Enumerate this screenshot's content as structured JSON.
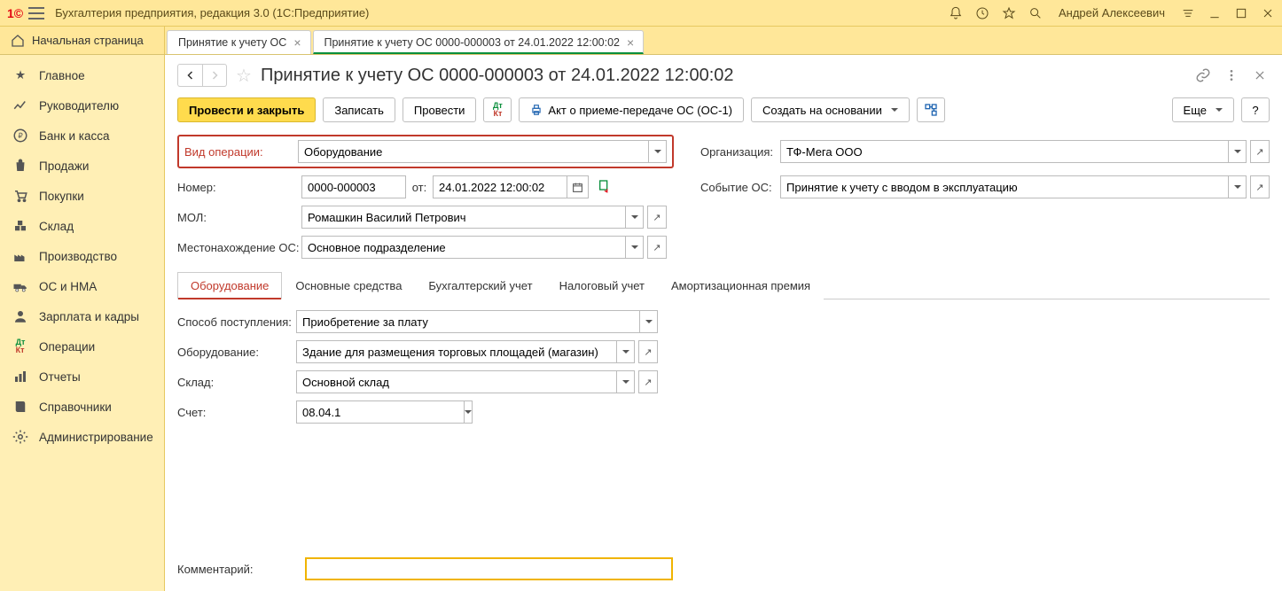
{
  "titlebar": {
    "app_title": "Бухгалтерия предприятия, редакция 3.0  (1С:Предприятие)",
    "user": "Андрей Алексеевич"
  },
  "hometab": "Начальная страница",
  "tabs": [
    {
      "label": "Принятие к учету ОС"
    },
    {
      "label": "Принятие к учету ОС 0000-000003 от 24.01.2022 12:00:02"
    }
  ],
  "sidebar": {
    "items": [
      "Главное",
      "Руководителю",
      "Банк и касса",
      "Продажи",
      "Покупки",
      "Склад",
      "Производство",
      "ОС и НМА",
      "Зарплата и кадры",
      "Операции",
      "Отчеты",
      "Справочники",
      "Администрирование"
    ]
  },
  "page": {
    "title": "Принятие к учету ОС 0000-000003 от 24.01.2022 12:00:02"
  },
  "toolbar": {
    "post_close": "Провести и закрыть",
    "write": "Записать",
    "post": "Провести",
    "print_act": "Акт о приеме-передаче ОС (ОС-1)",
    "create_based": "Создать на основании",
    "more": "Еще"
  },
  "form": {
    "op_type_lbl": "Вид операции:",
    "op_type_val": "Оборудование",
    "org_lbl": "Организация:",
    "org_val": "ТФ-Мега ООО",
    "num_lbl": "Номер:",
    "num_val": "0000-000003",
    "from_lbl": "от:",
    "date_val": "24.01.2022 12:00:02",
    "event_lbl": "Событие ОС:",
    "event_val": "Принятие к учету с вводом в эксплуатацию",
    "mol_lbl": "МОЛ:",
    "mol_val": "Ромашкин Василий Петрович",
    "loc_lbl": "Местонахождение ОС:",
    "loc_val": "Основное подразделение"
  },
  "subtabs": [
    "Оборудование",
    "Основные средства",
    "Бухгалтерский учет",
    "Налоговый учет",
    "Амортизационная премия"
  ],
  "equip": {
    "method_lbl": "Способ поступления:",
    "method_val": "Приобретение за плату",
    "equip_lbl": "Оборудование:",
    "equip_val": "Здание для размещения торговых площадей (магазин)",
    "wh_lbl": "Склад:",
    "wh_val": "Основной склад",
    "acct_lbl": "Счет:",
    "acct_val": "08.04.1"
  },
  "comment_lbl": "Комментарий:"
}
